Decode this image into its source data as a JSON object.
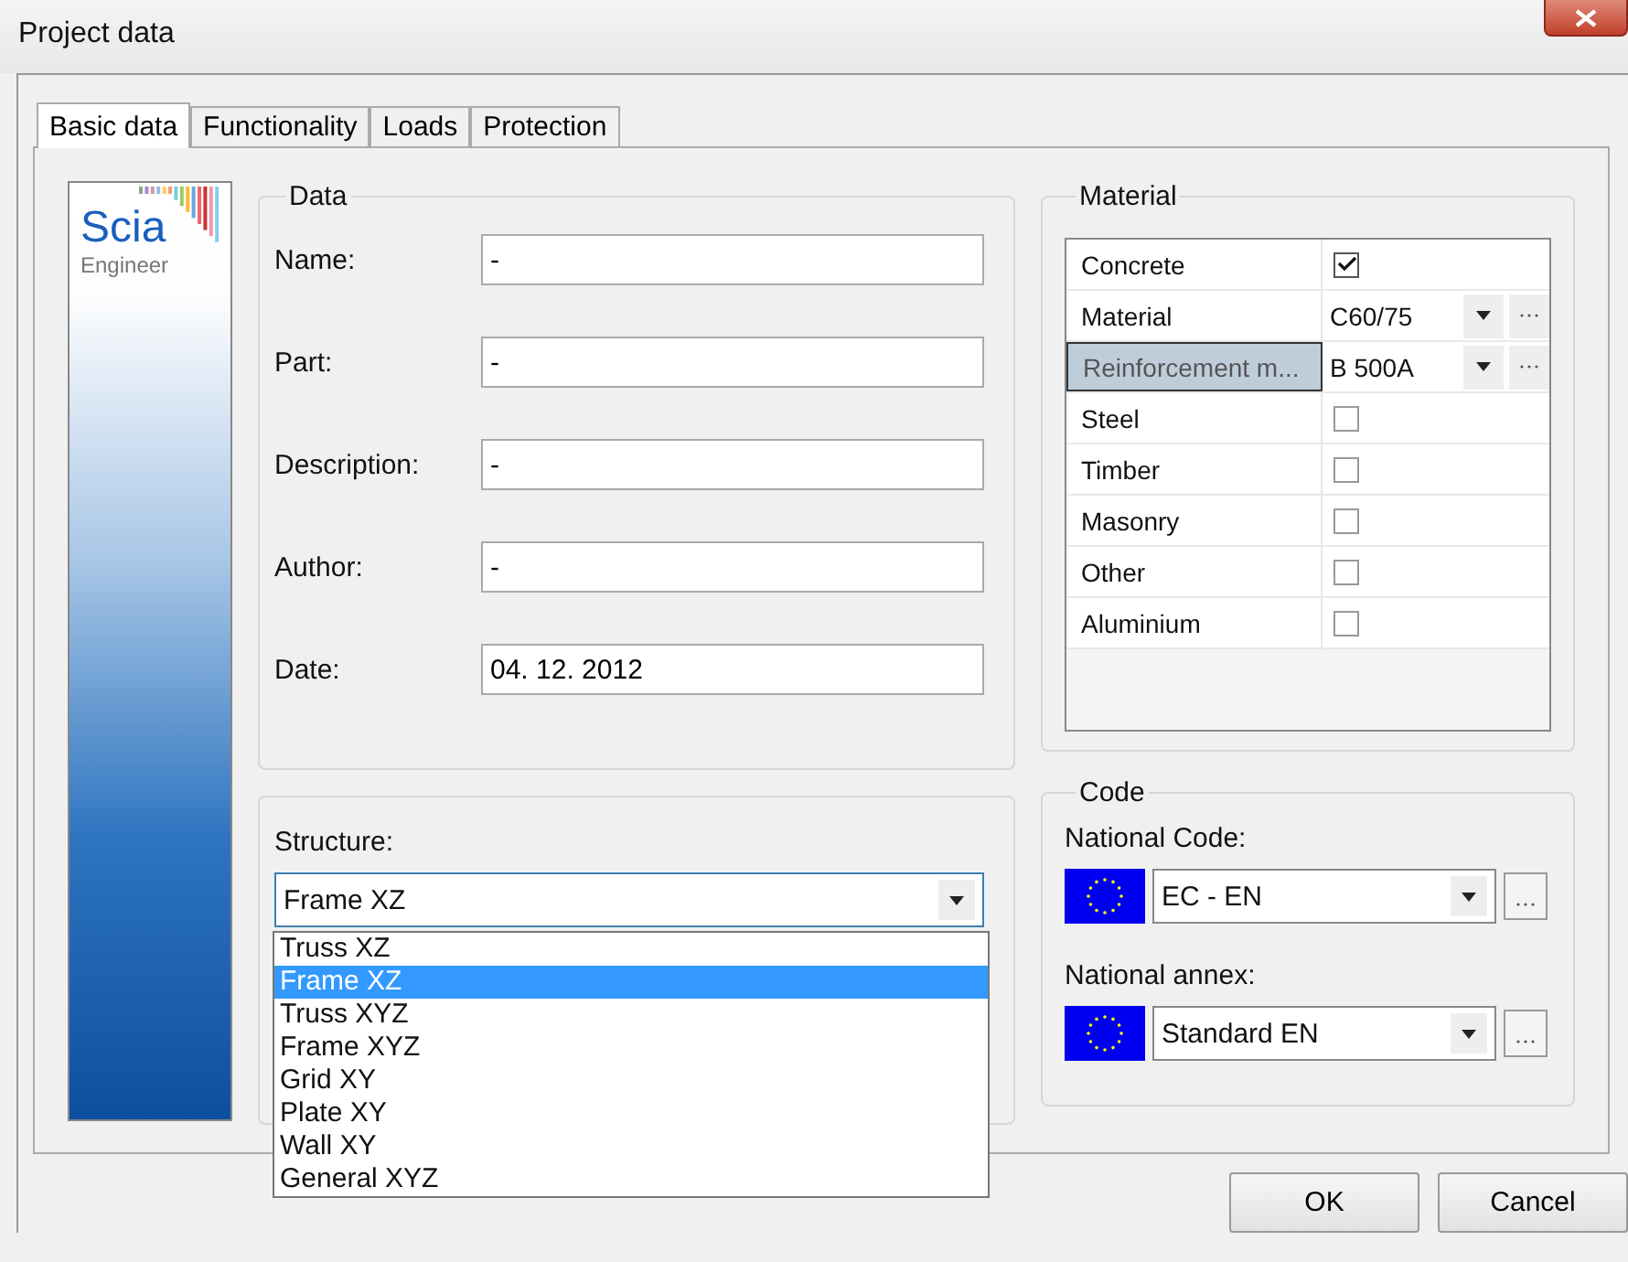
{
  "window": {
    "title": "Project data"
  },
  "logo": {
    "name": "Scia",
    "subtitle": "Engineer"
  },
  "tabs": [
    {
      "label": "Basic data",
      "selected": true
    },
    {
      "label": "Functionality",
      "selected": false
    },
    {
      "label": "Loads",
      "selected": false
    },
    {
      "label": "Protection",
      "selected": false
    }
  ],
  "data": {
    "title": "Data",
    "fields": [
      {
        "label": "Name:",
        "value": "-"
      },
      {
        "label": "Part:",
        "value": "-"
      },
      {
        "label": "Description:",
        "value": "-"
      },
      {
        "label": "Author:",
        "value": "-"
      },
      {
        "label": "Date:",
        "value": "04. 12. 2012"
      }
    ]
  },
  "structure": {
    "label": "Structure:",
    "value": "Frame XZ",
    "expanded": true,
    "options": [
      {
        "label": "Truss XZ",
        "selected": false
      },
      {
        "label": "Frame XZ",
        "selected": true
      },
      {
        "label": "Truss XYZ",
        "selected": false
      },
      {
        "label": "Frame XYZ",
        "selected": false
      },
      {
        "label": "Grid XY",
        "selected": false
      },
      {
        "label": "Plate XY",
        "selected": false
      },
      {
        "label": "Wall XY",
        "selected": false
      },
      {
        "label": "General XYZ",
        "selected": false
      }
    ]
  },
  "material": {
    "title": "Material",
    "rows": [
      {
        "kind": "checkbox",
        "label": "Concrete",
        "checked": true,
        "selected": false
      },
      {
        "kind": "select",
        "label": "Material",
        "value": "C60/75",
        "selected": false
      },
      {
        "kind": "select",
        "label": "Reinforcement m...",
        "value": "B 500A",
        "selected": true
      },
      {
        "kind": "checkbox",
        "label": "Steel",
        "checked": false,
        "selected": false
      },
      {
        "kind": "checkbox",
        "label": "Timber",
        "checked": false,
        "selected": false
      },
      {
        "kind": "checkbox",
        "label": "Masonry",
        "checked": false,
        "selected": false
      },
      {
        "kind": "checkbox",
        "label": "Other",
        "checked": false,
        "selected": false
      },
      {
        "kind": "checkbox",
        "label": "Aluminium",
        "checked": false,
        "selected": false
      }
    ]
  },
  "code": {
    "title": "Code",
    "fields": [
      {
        "label": "National Code:",
        "value": "EC - EN"
      },
      {
        "label": "National annex:",
        "value": "Standard EN"
      }
    ]
  },
  "buttons": [
    "OK",
    "Cancel"
  ]
}
